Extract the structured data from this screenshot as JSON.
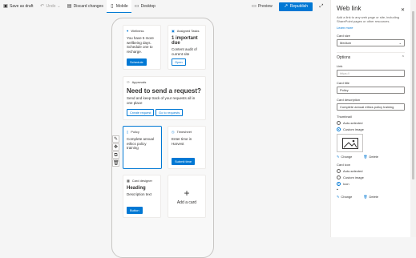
{
  "toolbar": {
    "save_draft": "Save as draft",
    "undo": "Undo",
    "discard": "Discard changes",
    "mobile": "Mobile",
    "desktop": "Desktop",
    "preview": "Preview",
    "republish": "Republish"
  },
  "cards": {
    "wellness": {
      "header": "Wellness",
      "text": "You have 5 more wellbeing days. Schedule one to recharge.",
      "button": "Schedule"
    },
    "tasks": {
      "header": "Assigned Tasks",
      "title": "1 important due",
      "text": "Content audit of current site",
      "button": "Open"
    },
    "approvals": {
      "header": "Approvals",
      "title": "Need to send a request?",
      "text": "Send and keep track of your requests all in one place",
      "button1": "Create request",
      "button2": "Go to requests"
    },
    "policy": {
      "header": "Policy",
      "text": "Complete annual ethics policy training"
    },
    "timesheet": {
      "header": "Timesheet",
      "text": "Enter time in Harvest",
      "button": "Submit time"
    },
    "designer": {
      "header": "Card designer",
      "title": "Heading",
      "text": "Description text",
      "button": "Button"
    },
    "add": {
      "label": "Add a card"
    }
  },
  "panel": {
    "title": "Web link",
    "desc": "Add a link to any web page or site, including SharePoint pages or other resources.",
    "learn_more": "Learn more",
    "card_size_label": "Card size",
    "card_size_value": "Medium",
    "options_label": "Options",
    "link_label": "Link",
    "link_placeholder": "https://",
    "card_title_label": "Card title",
    "card_title_value": "Policy",
    "card_desc_label": "Card description",
    "card_desc_value": "Complete annual ethics policy training",
    "thumbnail_label": "Thumbnail",
    "auto_selected": "Auto-selected",
    "custom_image": "Custom image",
    "change": "Change",
    "delete": "Delete",
    "card_icon_label": "Card icon",
    "icon_auto": "Auto-selected",
    "icon_custom": "Custom image",
    "icon_icon": "Icon",
    "change2": "Change",
    "delete2": "Delete"
  }
}
